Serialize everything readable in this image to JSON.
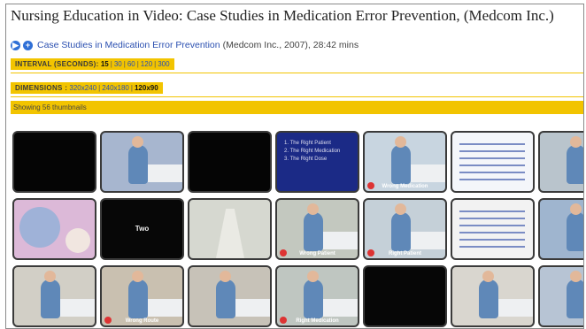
{
  "page": {
    "title": "Nursing Education in Video: Case Studies in Medication Error Prevention, (Medcom Inc.)"
  },
  "subline": {
    "icons": [
      "play-icon",
      "add-icon"
    ],
    "link_text": "Case Studies in Medication Error Prevention",
    "details": "(Medcom Inc., 2007), 28:42 mins"
  },
  "interval": {
    "label": "INTERVAL (SECONDS):",
    "options": [
      "15",
      "30",
      "60",
      "120",
      "300"
    ],
    "current": "15"
  },
  "dimensions": {
    "label": "DIMENSIONS :",
    "options": [
      "320x240",
      "240x180",
      "120x90"
    ],
    "current": "120x90"
  },
  "status": {
    "text": "Showing 56 thumbnails"
  },
  "thumbnails": [
    {
      "bg": "#050505",
      "style": "dark",
      "caption": "",
      "text": ""
    },
    {
      "bg": "#a7b6cf",
      "style": "nurse",
      "caption": "",
      "text": ""
    },
    {
      "bg": "#050505",
      "style": "dark",
      "caption": "",
      "text": ""
    },
    {
      "bg": "#1b2a86",
      "style": "slide",
      "caption": "",
      "text": "1. The Right Patient\n2. The Right Medication\n3. The Right Dose"
    },
    {
      "bg": "#c8d5e0",
      "style": "nurse",
      "caption": "Wrong Medication",
      "text": ""
    },
    {
      "bg": "#f4f6fa",
      "style": "doc",
      "caption": "",
      "text": ""
    },
    {
      "bg": "#b9c4cc",
      "style": "nurse",
      "caption": "",
      "text": ""
    },
    {
      "bg": "#dcb9d8",
      "style": "slide2",
      "caption": "",
      "text": ""
    },
    {
      "bg": "#070707",
      "style": "dark",
      "caption": "",
      "text": "Two"
    },
    {
      "bg": "#d6d8d0",
      "style": "hall",
      "caption": "",
      "text": ""
    },
    {
      "bg": "#c3c8bf",
      "style": "nurse",
      "caption": "Wrong Patient",
      "text": ""
    },
    {
      "bg": "#c5d0d8",
      "style": "nurse",
      "caption": "Right Patient",
      "text": ""
    },
    {
      "bg": "#f2f2f2",
      "style": "doc",
      "caption": "",
      "text": ""
    },
    {
      "bg": "#9fb5cf",
      "style": "nurse",
      "caption": "",
      "text": ""
    },
    {
      "bg": "#d2cfc6",
      "style": "nurse",
      "caption": "",
      "text": ""
    },
    {
      "bg": "#c9c0b0",
      "style": "nurse",
      "caption": "Wrong Route",
      "text": ""
    },
    {
      "bg": "#c7c2b8",
      "style": "nurse",
      "caption": "",
      "text": ""
    },
    {
      "bg": "#bfc6c1",
      "style": "nurse",
      "caption": "Right Medication",
      "text": ""
    },
    {
      "bg": "#060606",
      "style": "dark",
      "caption": "",
      "text": ""
    },
    {
      "bg": "#d9d6cf",
      "style": "nurse",
      "caption": "",
      "text": ""
    },
    {
      "bg": "#b7c4d4",
      "style": "nurse",
      "caption": "",
      "text": ""
    }
  ],
  "colors": {
    "accent_yellow": "#f2c400",
    "link_blue": "#2a4fb0"
  }
}
